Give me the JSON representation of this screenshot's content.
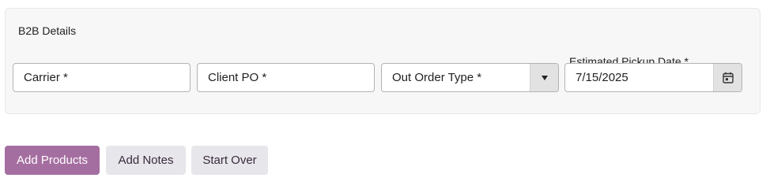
{
  "panel": {
    "title": "B2B Details"
  },
  "fields": {
    "carrier_placeholder": "Carrier *",
    "client_po_placeholder": "Client PO *",
    "out_order_type": {
      "selected": "Out Order Type *",
      "icon": "caret-down-icon"
    },
    "estimated_pickup": {
      "label": "Estimated Pickup Date *",
      "value": "7/15/2025",
      "icon": "calendar-icon"
    }
  },
  "actions": {
    "add_products": "Add Products",
    "add_notes": "Add Notes",
    "start_over": "Start Over"
  },
  "colors": {
    "primary_button": "#a56ea0",
    "secondary_button": "#e6e6eb",
    "panel_background": "#f7f7f7"
  }
}
